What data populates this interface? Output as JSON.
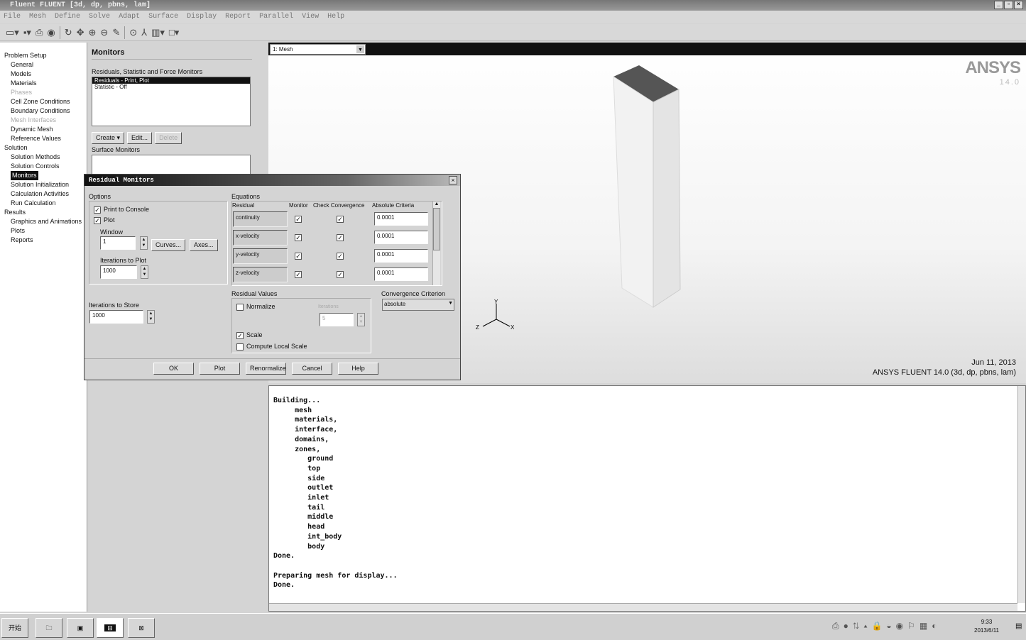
{
  "window": {
    "title": "Fluent FLUENT  [3d, dp, pbns, lam]",
    "controls": [
      "_",
      "▫",
      "×"
    ]
  },
  "menu": [
    "File",
    "Mesh",
    "Define",
    "Solve",
    "Adapt",
    "Surface",
    "Display",
    "Report",
    "Parallel",
    "View",
    "Help"
  ],
  "nav": {
    "sections": [
      {
        "label": "Problem Setup",
        "items": [
          {
            "label": "General"
          },
          {
            "label": "Models"
          },
          {
            "label": "Materials"
          },
          {
            "label": "Phases",
            "disabled": true
          },
          {
            "label": "Cell Zone Conditions"
          },
          {
            "label": "Boundary Conditions"
          },
          {
            "label": "Mesh Interfaces",
            "disabled": true
          },
          {
            "label": "Dynamic Mesh"
          },
          {
            "label": "Reference Values"
          }
        ]
      },
      {
        "label": "Solution",
        "items": [
          {
            "label": "Solution Methods"
          },
          {
            "label": "Solution Controls"
          },
          {
            "label": "Monitors",
            "selected": true
          },
          {
            "label": "Solution Initialization"
          },
          {
            "label": "Calculation Activities"
          },
          {
            "label": "Run Calculation"
          }
        ]
      },
      {
        "label": "Results",
        "items": [
          {
            "label": "Graphics and Animations"
          },
          {
            "label": "Plots"
          },
          {
            "label": "Reports"
          }
        ]
      }
    ]
  },
  "task": {
    "title": "Monitors",
    "monitors_label": "Residuals, Statistic and Force Monitors",
    "monitors": [
      "Residuals - Print, Plot",
      "Statistic - Off"
    ],
    "create": "Create",
    "edit": "Edit...",
    "delete": "Delete",
    "surface_label": "Surface Monitors"
  },
  "graphics": {
    "window_select": "1: Mesh",
    "logo": "ANSYS",
    "version": "14.0",
    "date": "Jun 11, 2013",
    "product": "ANSYS FLUENT 14.0 (3d, dp, pbns, lam)",
    "axes": {
      "x": "X",
      "y": "Y",
      "z": "Z"
    }
  },
  "console": {
    "text": "Building...\n     mesh\n     materials,\n     interface,\n     domains,\n     zones,\n        ground\n        top\n        side\n        outlet\n        inlet\n        tail\n        middle\n        head\n        int_body\n        body\nDone.\n\nPreparing mesh for display...\nDone."
  },
  "dialog": {
    "title": "Residual Monitors",
    "options_label": "Options",
    "print_to_console": "Print to Console",
    "plot": "Plot",
    "window_label": "Window",
    "window_value": "1",
    "curves": "Curves...",
    "axes": "Axes...",
    "iter_plot_label": "Iterations to Plot",
    "iter_plot_value": "1000",
    "iter_store_label": "Iterations to Store",
    "iter_store_value": "1000",
    "equations_label": "Equations",
    "columns": [
      "Residual",
      "Monitor",
      "Check Convergence",
      "Absolute Criteria"
    ],
    "rows": [
      {
        "residual": "continuity",
        "criteria": "0.0001"
      },
      {
        "residual": "x-velocity",
        "criteria": "0.0001"
      },
      {
        "residual": "y-velocity",
        "criteria": "0.0001"
      },
      {
        "residual": "z-velocity",
        "criteria": "0.0001"
      }
    ],
    "residual_values_label": "Residual Values",
    "normalize": "Normalize",
    "iterations_label": "Iterations",
    "iterations_value": "5",
    "scale": "Scale",
    "compute_local_scale": "Compute Local Scale",
    "conv_label": "Convergence Criterion",
    "conv_value": "absolute",
    "buttons": [
      "OK",
      "Plot",
      "Renormalize",
      "Cancel",
      "Help"
    ]
  },
  "taskbar": {
    "start": "开始",
    "clock_time": "9:33",
    "clock_date": "2013/6/11"
  }
}
